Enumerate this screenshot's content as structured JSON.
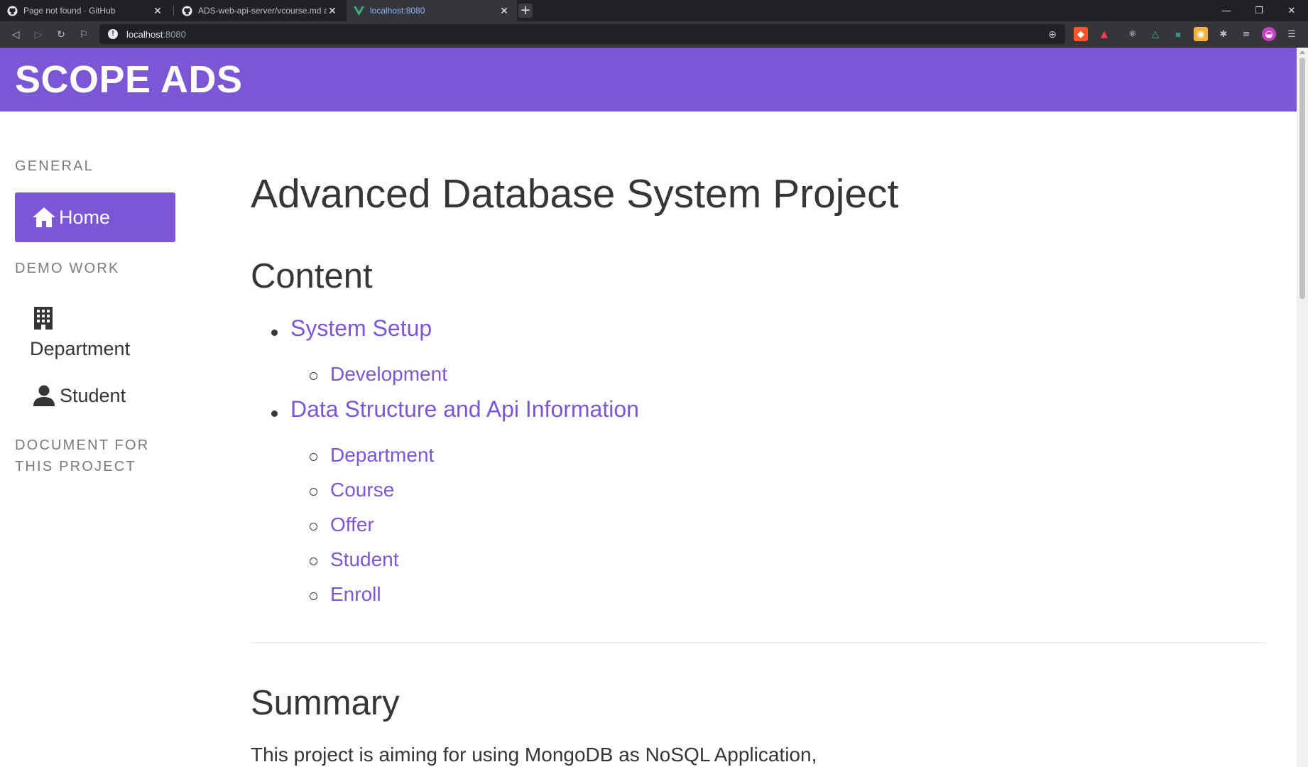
{
  "browser": {
    "tabs": [
      {
        "title": "Page not found · GitHub",
        "favicon": "github-icon"
      },
      {
        "title": "ADS-web-api-server/vcourse.md a",
        "favicon": "github-icon"
      },
      {
        "title": "localhost:8080",
        "favicon": "vue-icon",
        "active": true
      }
    ],
    "address": {
      "host": "localhost",
      "port": ":8080"
    },
    "accent": "#8ab4f8"
  },
  "site": {
    "brand": "SCOPE ADS",
    "brand_color": "#7b57d6"
  },
  "sidebar": {
    "general_label": "GENERAL",
    "home": {
      "label": "Home",
      "icon": "home-icon"
    },
    "demo_label": "DEMO WORK",
    "department": {
      "label": "Department",
      "icon": "building-icon"
    },
    "student": {
      "label": "Student",
      "icon": "person-icon"
    },
    "doc_label_line1": "DOCUMENT FOR",
    "doc_label_line2": "THIS PROJECT"
  },
  "main": {
    "title": "Advanced Database System Project",
    "content_heading": "Content",
    "toc": {
      "system_setup": "System Setup",
      "development": "Development",
      "data_structure": "Data Structure and Api Information",
      "items": [
        "Department",
        "Course",
        "Offer",
        "Student",
        "Enroll"
      ]
    },
    "summary_heading": "Summary",
    "summary_text": "This project is aiming for using MongoDB as NoSQL Application,"
  }
}
